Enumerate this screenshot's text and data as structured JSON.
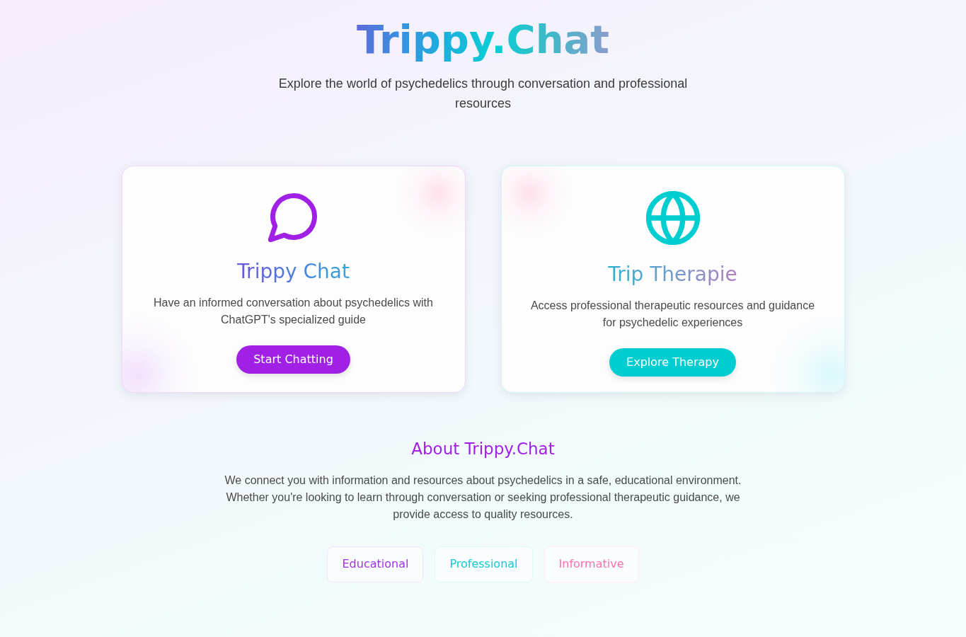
{
  "header": {
    "title": "Trippy.Chat",
    "subtitle": "Explore the world of psychedelics through conversation and professional resources"
  },
  "cards": [
    {
      "kind": "chat",
      "color": "#a020e6",
      "title": "Trippy Chat",
      "description": "Have an informed conversation about psychedelics with ChatGPT's specialized guide",
      "button": "Start Chatting"
    },
    {
      "kind": "therapy",
      "color": "#00cdd0",
      "title": "Trip Therapie",
      "description": "Access professional therapeutic resources and guidance for psychedelic experiences",
      "button": "Explore Therapy"
    }
  ],
  "about": {
    "title": "About Trippy.Chat",
    "text": "We connect you with information and resources about psychedelics in a safe, educational environment. Whether you're looking to learn through conversation or seeking professional therapeutic guidance, we provide access to quality resources.",
    "tags": [
      {
        "label": "Educational",
        "color": "#a030e8"
      },
      {
        "label": "Professional",
        "color": "#12cbd2"
      },
      {
        "label": "Informative",
        "color": "#ff6fb2"
      }
    ]
  }
}
